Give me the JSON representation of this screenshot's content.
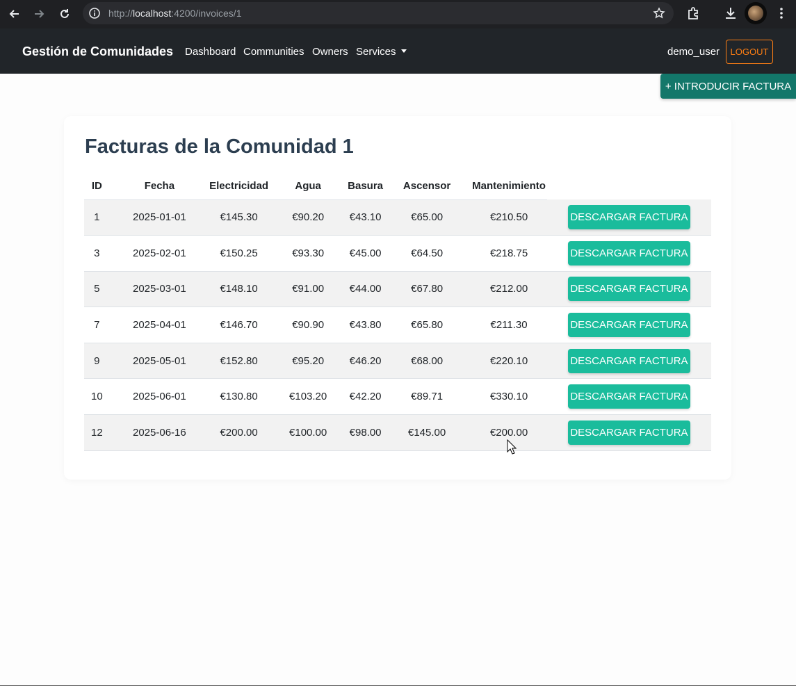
{
  "browser": {
    "url_prefix": "http://",
    "url_host": "localhost",
    "url_path": ":4200/invoices/1",
    "icons": [
      "back-icon",
      "forward-icon",
      "reload-icon",
      "info-icon",
      "star-icon",
      "extensions-icon",
      "download-icon",
      "profile-avatar",
      "more-icon"
    ]
  },
  "navbar": {
    "brand": "Gestión de Comunidades",
    "links": [
      "Dashboard",
      "Communities",
      "Owners",
      "Services"
    ],
    "user": "demo_user",
    "logout_label": "LOGOUT"
  },
  "page": {
    "add_button_label": "+ INTRODUCIR FACTURA",
    "title": "Facturas de la Comunidad 1",
    "download_label": "DESCARGAR FACTURA"
  },
  "table": {
    "headers": [
      "ID",
      "Fecha",
      "Electricidad",
      "Agua",
      "Basura",
      "Ascensor",
      "Mantenimiento"
    ],
    "rows": [
      [
        "1",
        "2025-01-01",
        "€145.30",
        "€90.20",
        "€43.10",
        "€65.00",
        "€210.50"
      ],
      [
        "3",
        "2025-02-01",
        "€150.25",
        "€93.30",
        "€45.00",
        "€64.50",
        "€218.75"
      ],
      [
        "5",
        "2025-03-01",
        "€148.10",
        "€91.00",
        "€44.00",
        "€67.80",
        "€212.00"
      ],
      [
        "7",
        "2025-04-01",
        "€146.70",
        "€90.90",
        "€43.80",
        "€65.80",
        "€211.30"
      ],
      [
        "9",
        "2025-05-01",
        "€152.80",
        "€95.20",
        "€46.20",
        "€68.00",
        "€220.10"
      ],
      [
        "10",
        "2025-06-01",
        "€130.80",
        "€103.20",
        "€42.20",
        "€89.71",
        "€330.10"
      ],
      [
        "12",
        "2025-06-16",
        "€200.00",
        "€100.00",
        "€98.00",
        "€145.00",
        "€200.00"
      ]
    ]
  },
  "colors": {
    "navbar_bg": "#212529",
    "logout": "#fd7e14",
    "add_button": "#13776a",
    "download_button": "#1abc9c",
    "title": "#2c3e50"
  }
}
